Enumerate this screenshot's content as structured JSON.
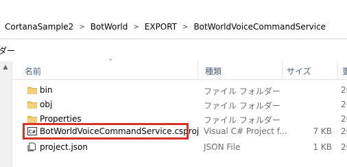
{
  "breadcrumb": [
    "CortanaSample2",
    "BotWorld",
    "EXPORT",
    "BotWorldVoiceCommandService"
  ],
  "toolbar": {
    "label": "ダー"
  },
  "columns": {
    "name": "名前",
    "type": "種類",
    "size": "サイズ",
    "date": "更"
  },
  "files": [
    {
      "name": "bin",
      "type": "ファイル フォルダー",
      "size": "",
      "date": "20",
      "icon": "folder-icon"
    },
    {
      "name": "obj",
      "type": "ファイル フォルダー",
      "size": "",
      "date": "20",
      "icon": "folder-icon"
    },
    {
      "name": "Properties",
      "type": "ファイル フォルダー",
      "size": "",
      "date": "20",
      "icon": "folder-icon"
    },
    {
      "name": "BotWorldVoiceCommandService.csproj",
      "type": "Visual C# Project f...",
      "size": "7 KB",
      "date": "20",
      "icon": "csharp-project-icon"
    },
    {
      "name": "project.json",
      "type": "JSON File",
      "size": "1 KB",
      "date": "20",
      "icon": "json-file-icon"
    }
  ],
  "colors": {
    "highlight": "#d53325",
    "folder": "#e8c15b",
    "header_text": "#4c607a"
  }
}
